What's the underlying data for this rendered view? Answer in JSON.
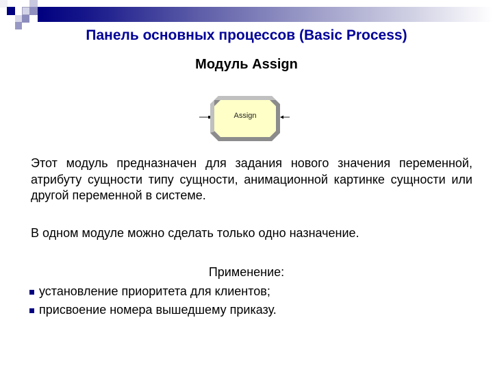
{
  "colors": {
    "accent": "#000080",
    "title": "#000099",
    "module_fill": "#FFFFC8",
    "module_border_light": "#BEBEBE",
    "module_border_dark": "#8C8C8C"
  },
  "header": {
    "title": "Панель основных процессов (Basic Process)",
    "subtitle": "Модуль Assign"
  },
  "figure": {
    "module_label": "Assign",
    "icon": "arena-assign-module-icon"
  },
  "body": {
    "description": "Этот модуль предназначен для задания нового значения переменной, атрибуту сущности типу сущности, анимационной картинке сущности или другой переменной в системе.",
    "note": "В одном модуле можно сделать только одно назначение.",
    "usage_heading": "Применение:",
    "usage_items": [
      {
        "text": "установление приоритета для клиентов;"
      },
      {
        "text": "присвоение номера вышедшему приказу."
      }
    ]
  }
}
